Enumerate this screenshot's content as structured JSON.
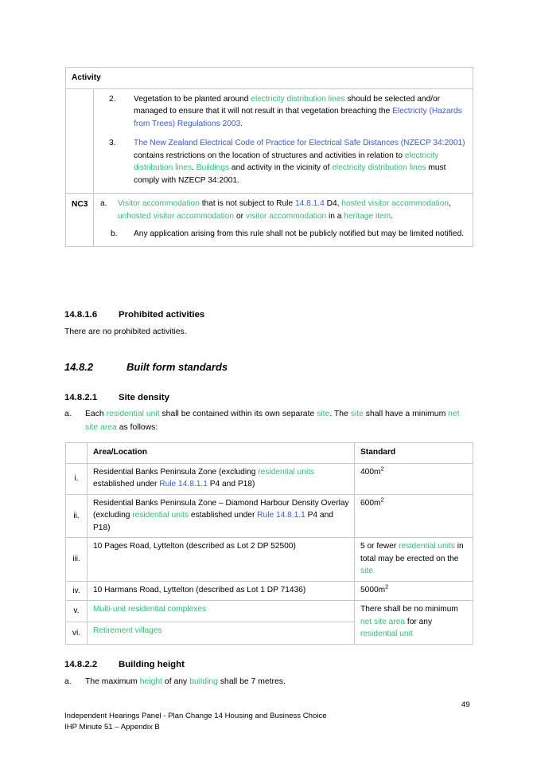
{
  "table_activity": {
    "header": "Activity",
    "rows": [
      {
        "code": "",
        "items": [
          {
            "marker": "2.",
            "text": "Vegetation to be planted around electricity distribution lines should be selected and/or managed to ensure that it will not result in that vegetation breaching the Electricity (Hazards from Trees) Regulations 2003."
          },
          {
            "marker": "3.",
            "text": "The New Zealand Electrical Code of Practice for Electrical Safe Distances (NZECP 34:2001) contains restrictions on the location of structures and activities in relation to electricity distribution lines. Buildings and activity in the vicinity of electricity distribution lines must comply with NZECP 34:2001."
          }
        ]
      },
      {
        "code": "NC3",
        "items": [
          {
            "marker": "a.",
            "text": "Visitor accommodation that is not subject to Rule 14.8.1.4 D4, hosted visitor accommodation, unhosted visitor accommodation or visitor accommodation in a heritage item."
          },
          {
            "marker": "b.",
            "text": "Any application arising from this rule shall not be publicly notified but may be limited notified."
          }
        ]
      }
    ]
  },
  "section_prohibited": {
    "number": "14.8.1.6",
    "title": "Prohibited activities",
    "body": "There are no prohibited activities."
  },
  "section_built_form": {
    "number": "14.8.2",
    "title": "Built form standards"
  },
  "section_site_density": {
    "number": "14.8.2.1",
    "title": "Site density",
    "clause_marker": "a.",
    "clause_text": "Each residential unit shall be contained within its own separate site. The site shall have a minimum net site area as follows:"
  },
  "table_density": {
    "headers": {
      "num": "",
      "area": "Area/Location",
      "standard": "Standard"
    },
    "rows": [
      {
        "num": "i.",
        "area": "Residential Banks Peninsula Zone (excluding residential units established under Rule 14.8.1.1 P4 and P18)",
        "standard": "400m2"
      },
      {
        "num": "ii.",
        "area": "Residential Banks Peninsula Zone – Diamond Harbour Density Overlay (excluding residential units established under Rule 14.8.1.1 P4 and P18)",
        "standard": "600m2"
      },
      {
        "num": "iii.",
        "area": "10 Pages Road, Lyttelton (described as Lot 2 DP 52500)",
        "standard": "5 or fewer residential units in total may be erected on the site"
      },
      {
        "num": "iv.",
        "area": "10 Harmans Road, Lyttelton (described as Lot 1 DP 71436)",
        "standard": "5000m2"
      },
      {
        "num": "v.",
        "area": "Multi-unit residential complexes",
        "standard": "There shall be no minimum net site area for any residential unit"
      },
      {
        "num": "vi.",
        "area": "Retirement villages",
        "standard": ""
      }
    ]
  },
  "section_building_height": {
    "number": "14.8.2.2",
    "title": "Building height",
    "clause_marker": "a.",
    "clause_text": "The maximum height of any building shall be 7 metres."
  },
  "footer": {
    "page_number": "49",
    "line1": "Independent Hearings Panel - Plan Change 14 Housing and Business Choice",
    "line2": "IHP Minute 51 – Appendix B"
  },
  "colors": {
    "definition_green": "#34bb74",
    "cross_reference_blue": "#3b5bce",
    "table_border": "#c9c9c9",
    "text": "#000000"
  }
}
